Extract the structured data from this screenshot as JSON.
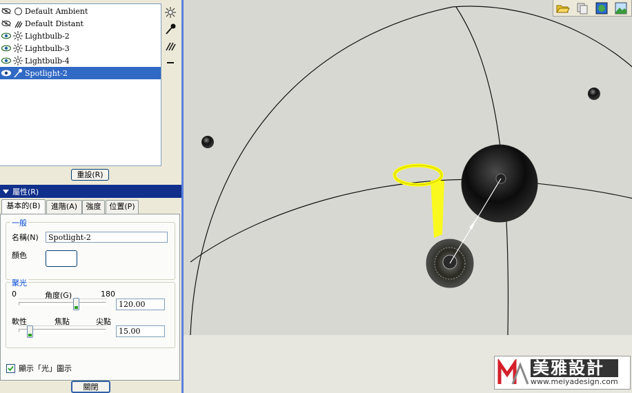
{
  "lights": [
    {
      "label": "Default Ambient",
      "icon": "ambient-light-icon",
      "visible": false
    },
    {
      "label": "Default Distant",
      "icon": "distant-light-icon",
      "visible": false
    },
    {
      "label": "Lightbulb-2",
      "icon": "bulb-light-icon",
      "visible": true
    },
    {
      "label": "Lightbulb-3",
      "icon": "bulb-light-icon",
      "visible": true
    },
    {
      "label": "Lightbulb-4",
      "icon": "bulb-light-icon",
      "visible": true
    },
    {
      "label": "Spotlight-2",
      "icon": "spotlight-icon",
      "visible": true,
      "selected": true
    }
  ],
  "reset_button": "重設(R)",
  "properties_header": "屬性(R)",
  "tabs": [
    "基本的(B)",
    "進階(A)",
    "強度",
    "位置(P)"
  ],
  "general": {
    "title": "一般",
    "name_label": "名稱(N)",
    "name_value": "Spotlight-2",
    "color_label": "顏色"
  },
  "spot": {
    "title": "聚光",
    "angle_min": "0",
    "angle_label": "角度(G)",
    "angle_max": "180",
    "angle_value": "120.00",
    "softness_label": "軟性",
    "focus_label": "焦點",
    "sharp_label": "尖點",
    "focus_value": "15.00"
  },
  "show_light_checkbox": "顯示「光」圖示",
  "show_light_checked": true,
  "close_button": "關閉",
  "watermark": {
    "brand": "美雅設計",
    "url": "www.meiyadesign.com"
  },
  "colors": {
    "selection": "#316ac5",
    "header": "#10308c",
    "spot_ring": "#ffff00"
  }
}
